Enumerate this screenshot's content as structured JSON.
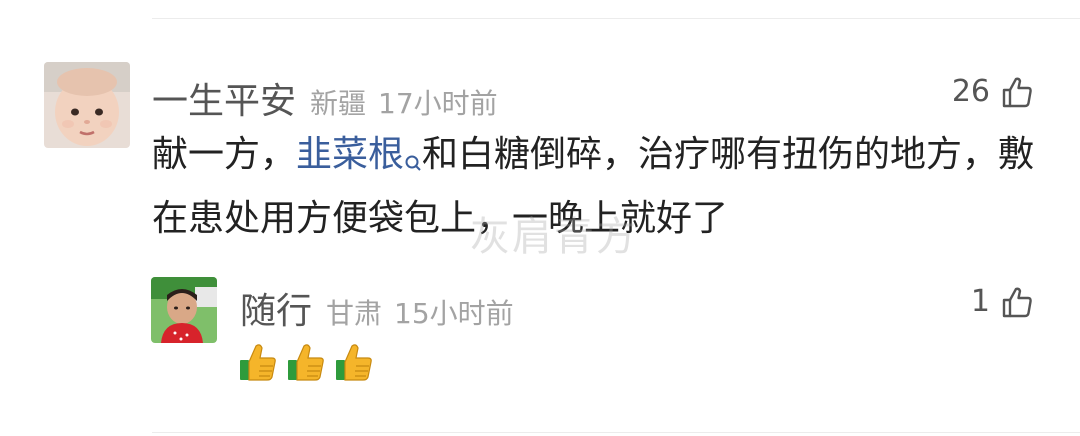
{
  "comment": {
    "username": "一生平安",
    "location": "新疆",
    "time": "17小时前",
    "likes": "26",
    "text_before": "献一方，",
    "link_text": "韭菜根",
    "text_after": "和白糖倒碎，治疗哪有扭伤的地方，敷在患处用方便袋包上，一晚上就好了",
    "avatar_icon": "baby-photo-avatar"
  },
  "reply": {
    "username": "随行",
    "location": "甘肃",
    "time": "15小时前",
    "likes": "1",
    "emojis": [
      "thumbs-up",
      "thumbs-up",
      "thumbs-up"
    ],
    "avatar_icon": "child-photo-avatar"
  },
  "watermark": "灰肩青方",
  "colors": {
    "username": "#555555",
    "meta": "#a3a3a3",
    "link": "#3a5e9c",
    "text": "#222222"
  },
  "icons": {
    "like": "thumbs-up-outline-icon",
    "search": "search-icon"
  }
}
